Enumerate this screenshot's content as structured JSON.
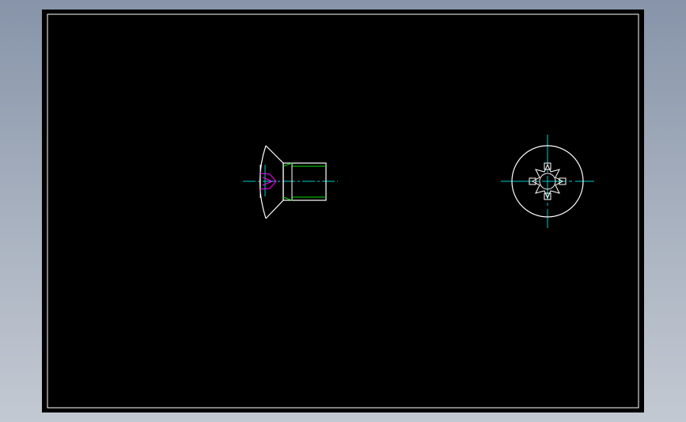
{
  "canvas": {
    "background_color": "#000000",
    "viewport_gradient": [
      "#8794a9",
      "#c3c9d2"
    ]
  },
  "drawing": {
    "frame_color": "#ffffff",
    "object_color": "#ffffff",
    "centerline_color": "#00c8c8",
    "thread_color": "#00dd00",
    "recess_color": "#ff00ff",
    "views": [
      {
        "name": "side-view",
        "subject": "countersunk-screw"
      },
      {
        "name": "end-view",
        "subject": "screw-head-with-star-recess"
      }
    ]
  }
}
